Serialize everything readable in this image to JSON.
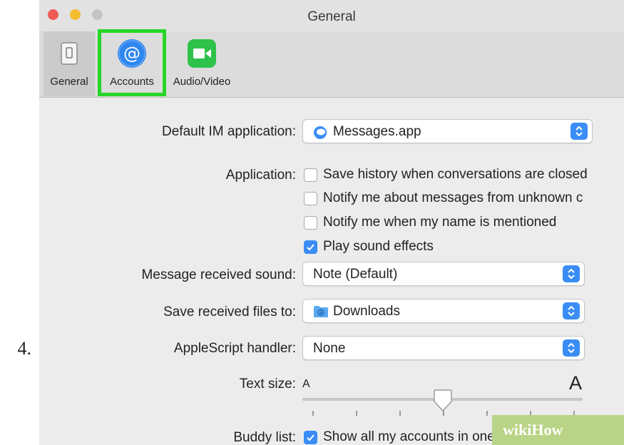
{
  "step_number": "4.",
  "window": {
    "title": "General",
    "traffic_lights": {
      "close": "#ee5b55",
      "minimize": "#f4bc2f",
      "zoom": "#c4c4c4"
    }
  },
  "toolbar": {
    "tabs": [
      {
        "label": "General",
        "icon": "phone-switch-icon"
      },
      {
        "label": "Accounts",
        "icon": "at-sign-icon",
        "highlighted": true
      },
      {
        "label": "Audio/Video",
        "icon": "video-camera-icon"
      }
    ],
    "highlight_color": "#27d627"
  },
  "settings": {
    "default_im": {
      "label": "Default IM application:",
      "value": "Messages.app",
      "icon": "messages-app-icon"
    },
    "application": {
      "label": "Application:",
      "options": [
        {
          "text": "Save history when conversations are closed",
          "checked": false
        },
        {
          "text": "Notify me about messages from unknown c",
          "checked": false
        },
        {
          "text": "Notify me when my name is mentioned",
          "checked": false
        },
        {
          "text": "Play sound effects",
          "checked": true
        }
      ]
    },
    "message_sound": {
      "label": "Message received sound:",
      "value": "Note (Default)"
    },
    "save_files": {
      "label": "Save received files to:",
      "value": "Downloads",
      "icon": "downloads-folder-icon"
    },
    "applescript": {
      "label": "AppleScript handler:",
      "value": "None"
    },
    "text_size": {
      "label": "Text size:",
      "small_glyph": "A",
      "large_glyph": "A",
      "level": 0.5
    },
    "buddy_list": {
      "label": "Buddy list:",
      "option": "Show all my accounts in one list",
      "checked": true
    }
  },
  "watermark": {
    "text": "wikiHow",
    "color": "#b9d486"
  },
  "accent_color": "#3a8df5"
}
